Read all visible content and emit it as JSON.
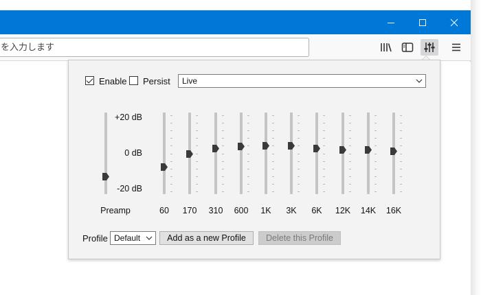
{
  "window": {
    "title_buttons": [
      {
        "name": "minimize",
        "icon": "minimize-icon"
      },
      {
        "name": "maximize",
        "icon": "maximize-icon"
      },
      {
        "name": "close",
        "icon": "close-icon"
      }
    ],
    "accent_color": "#0078d7"
  },
  "toolbar": {
    "url_placeholder": "を入力します",
    "icons": [
      "library-icon",
      "sidebar-icon",
      "equalizer-icon",
      "hamburger-menu-icon"
    ]
  },
  "eq": {
    "enable_label": "Enable",
    "enable_checked": true,
    "persist_label": "Persist",
    "persist_checked": false,
    "preset_value": "Live",
    "db_labels": {
      "top": "+20 dB",
      "mid": "0 dB",
      "bottom": "-20 dB"
    },
    "preamp_label": "Preamp",
    "preamp_value": -12,
    "bands": [
      {
        "label": "60",
        "value": -7
      },
      {
        "label": "170",
        "value": 0
      },
      {
        "label": "310",
        "value": 3
      },
      {
        "label": "600",
        "value": 4
      },
      {
        "label": "1K",
        "value": 4.5
      },
      {
        "label": "3K",
        "value": 4.5
      },
      {
        "label": "6K",
        "value": 3
      },
      {
        "label": "12K",
        "value": 2
      },
      {
        "label": "14K",
        "value": 2
      },
      {
        "label": "16K",
        "value": 1.5
      }
    ],
    "profile_label": "Profile",
    "profile_value": "Default",
    "add_profile_label": "Add as a new Profile",
    "delete_profile_label": "Delete this Profile"
  }
}
